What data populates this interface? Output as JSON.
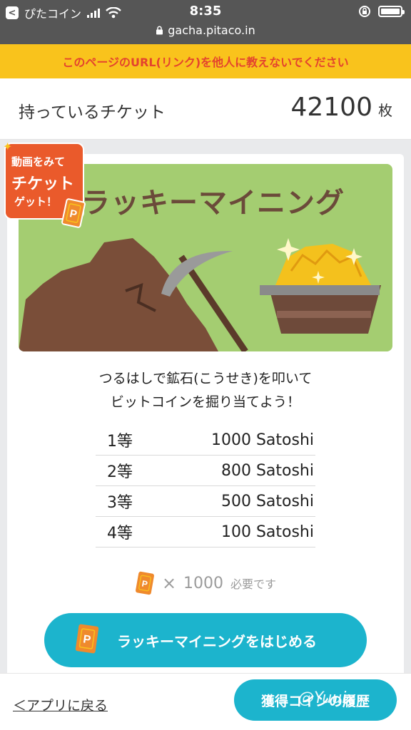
{
  "status_bar": {
    "back_app": "ぴたコイン",
    "time": "8:35",
    "url": "gacha.pitaco.in"
  },
  "warning": "このページのURL(リンク)を他人に教えないでください",
  "tickets": {
    "label": "持っているチケット",
    "count": "42100",
    "unit": "枚"
  },
  "banner": {
    "title": "ラッキーマイニング"
  },
  "badge": {
    "line1": "動画をみて",
    "line2": "チケット",
    "line3": "ゲット！",
    "ticket_letter": "P"
  },
  "description": {
    "line1": "つるはしで鉱石(こうせき)を叩いて",
    "line2": "ビットコインを掘り当てよう！"
  },
  "prizes": [
    {
      "rank": "1等",
      "reward": "1000 Satoshi"
    },
    {
      "rank": "2等",
      "reward": "800 Satoshi"
    },
    {
      "rank": "3等",
      "reward": "500 Satoshi"
    },
    {
      "rank": "4等",
      "reward": "100 Satoshi"
    }
  ],
  "cost": {
    "ticket_letter": "P",
    "times": "×",
    "amount": "1000",
    "required": "必要です"
  },
  "start_button": {
    "ticket_letter": "P",
    "label": "ラッキーマイニングをはじめる"
  },
  "footer": {
    "back_link": "＜アプリに戻る",
    "history_button": "獲得コインの履歴",
    "watermark": "@Yuuix"
  },
  "colors": {
    "status_bar": "#565656",
    "warning_bg": "#f9c31c",
    "warning_text": "#e4432e",
    "accent": "#1cb4cd",
    "banner_bg": "#a4cd71",
    "badge_bg": "#ea5a2b",
    "ticket": "#ef8a2d"
  },
  "icons": [
    "back-arrow-icon",
    "signal-icon",
    "wifi-icon",
    "rotation-lock-icon",
    "battery-icon",
    "lock-icon",
    "ticket-icon",
    "pickaxe-icon",
    "gold-cart-icon",
    "sparkle-icon"
  ]
}
